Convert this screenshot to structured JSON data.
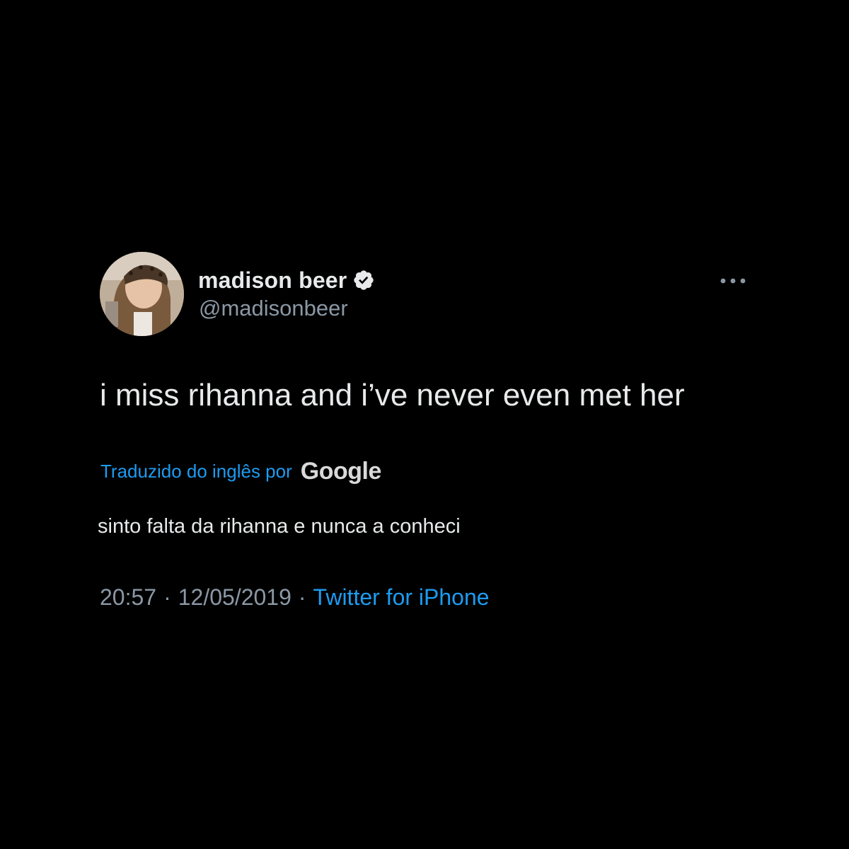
{
  "tweet": {
    "display_name": "madison beer",
    "handle": "@madisonbeer",
    "verified_icon": "verified-badge-icon",
    "more_icon": "more-dots-icon",
    "text": "i miss rihanna and i’ve never even met her",
    "translation": {
      "label": "Traduzido do inglês por",
      "provider": "Google",
      "text": "sinto falta da rihanna e nunca a conheci"
    },
    "time": "20:57",
    "separator": "·",
    "date": "12/05/2019",
    "source": "Twitter for iPhone"
  },
  "colors": {
    "background": "#000000",
    "primary_text": "#e7e9ea",
    "secondary_text": "#8b98a5",
    "accent": "#1d9bf0"
  }
}
